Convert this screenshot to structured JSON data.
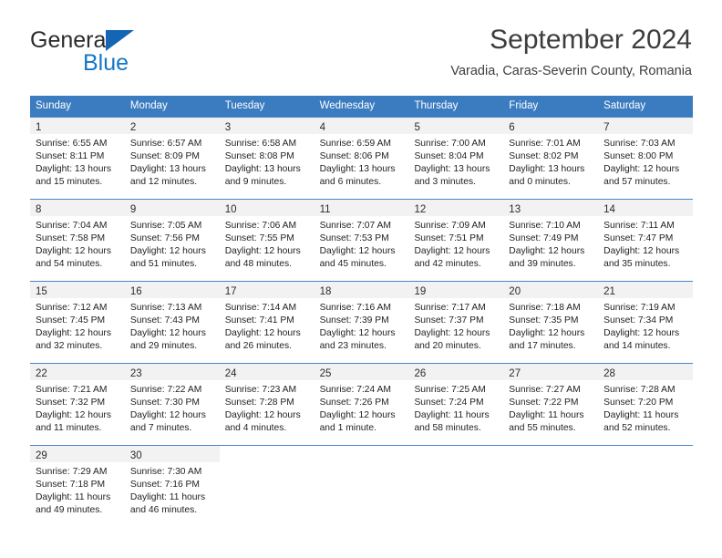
{
  "brand": {
    "word_one": "General",
    "word_two": "Blue",
    "accent_color": "#1477c7",
    "triangle_color": "#1565b5",
    "logo_icon": "general-blue-logo"
  },
  "header": {
    "month_title": "September 2024",
    "location": "Varadia, Caras-Severin County, Romania"
  },
  "calendar": {
    "header_bg_color": "#3b7cc0",
    "date_band_color": "#f2f2f2",
    "weekdays": [
      "Sunday",
      "Monday",
      "Tuesday",
      "Wednesday",
      "Thursday",
      "Friday",
      "Saturday"
    ],
    "weeks": [
      [
        {
          "day": "1",
          "sunrise": "Sunrise: 6:55 AM",
          "sunset": "Sunset: 8:11 PM",
          "daylight_line1": "Daylight: 13 hours",
          "daylight_line2": "and 15 minutes."
        },
        {
          "day": "2",
          "sunrise": "Sunrise: 6:57 AM",
          "sunset": "Sunset: 8:09 PM",
          "daylight_line1": "Daylight: 13 hours",
          "daylight_line2": "and 12 minutes."
        },
        {
          "day": "3",
          "sunrise": "Sunrise: 6:58 AM",
          "sunset": "Sunset: 8:08 PM",
          "daylight_line1": "Daylight: 13 hours",
          "daylight_line2": "and 9 minutes."
        },
        {
          "day": "4",
          "sunrise": "Sunrise: 6:59 AM",
          "sunset": "Sunset: 8:06 PM",
          "daylight_line1": "Daylight: 13 hours",
          "daylight_line2": "and 6 minutes."
        },
        {
          "day": "5",
          "sunrise": "Sunrise: 7:00 AM",
          "sunset": "Sunset: 8:04 PM",
          "daylight_line1": "Daylight: 13 hours",
          "daylight_line2": "and 3 minutes."
        },
        {
          "day": "6",
          "sunrise": "Sunrise: 7:01 AM",
          "sunset": "Sunset: 8:02 PM",
          "daylight_line1": "Daylight: 13 hours",
          "daylight_line2": "and 0 minutes."
        },
        {
          "day": "7",
          "sunrise": "Sunrise: 7:03 AM",
          "sunset": "Sunset: 8:00 PM",
          "daylight_line1": "Daylight: 12 hours",
          "daylight_line2": "and 57 minutes."
        }
      ],
      [
        {
          "day": "8",
          "sunrise": "Sunrise: 7:04 AM",
          "sunset": "Sunset: 7:58 PM",
          "daylight_line1": "Daylight: 12 hours",
          "daylight_line2": "and 54 minutes."
        },
        {
          "day": "9",
          "sunrise": "Sunrise: 7:05 AM",
          "sunset": "Sunset: 7:56 PM",
          "daylight_line1": "Daylight: 12 hours",
          "daylight_line2": "and 51 minutes."
        },
        {
          "day": "10",
          "sunrise": "Sunrise: 7:06 AM",
          "sunset": "Sunset: 7:55 PM",
          "daylight_line1": "Daylight: 12 hours",
          "daylight_line2": "and 48 minutes."
        },
        {
          "day": "11",
          "sunrise": "Sunrise: 7:07 AM",
          "sunset": "Sunset: 7:53 PM",
          "daylight_line1": "Daylight: 12 hours",
          "daylight_line2": "and 45 minutes."
        },
        {
          "day": "12",
          "sunrise": "Sunrise: 7:09 AM",
          "sunset": "Sunset: 7:51 PM",
          "daylight_line1": "Daylight: 12 hours",
          "daylight_line2": "and 42 minutes."
        },
        {
          "day": "13",
          "sunrise": "Sunrise: 7:10 AM",
          "sunset": "Sunset: 7:49 PM",
          "daylight_line1": "Daylight: 12 hours",
          "daylight_line2": "and 39 minutes."
        },
        {
          "day": "14",
          "sunrise": "Sunrise: 7:11 AM",
          "sunset": "Sunset: 7:47 PM",
          "daylight_line1": "Daylight: 12 hours",
          "daylight_line2": "and 35 minutes."
        }
      ],
      [
        {
          "day": "15",
          "sunrise": "Sunrise: 7:12 AM",
          "sunset": "Sunset: 7:45 PM",
          "daylight_line1": "Daylight: 12 hours",
          "daylight_line2": "and 32 minutes."
        },
        {
          "day": "16",
          "sunrise": "Sunrise: 7:13 AM",
          "sunset": "Sunset: 7:43 PM",
          "daylight_line1": "Daylight: 12 hours",
          "daylight_line2": "and 29 minutes."
        },
        {
          "day": "17",
          "sunrise": "Sunrise: 7:14 AM",
          "sunset": "Sunset: 7:41 PM",
          "daylight_line1": "Daylight: 12 hours",
          "daylight_line2": "and 26 minutes."
        },
        {
          "day": "18",
          "sunrise": "Sunrise: 7:16 AM",
          "sunset": "Sunset: 7:39 PM",
          "daylight_line1": "Daylight: 12 hours",
          "daylight_line2": "and 23 minutes."
        },
        {
          "day": "19",
          "sunrise": "Sunrise: 7:17 AM",
          "sunset": "Sunset: 7:37 PM",
          "daylight_line1": "Daylight: 12 hours",
          "daylight_line2": "and 20 minutes."
        },
        {
          "day": "20",
          "sunrise": "Sunrise: 7:18 AM",
          "sunset": "Sunset: 7:35 PM",
          "daylight_line1": "Daylight: 12 hours",
          "daylight_line2": "and 17 minutes."
        },
        {
          "day": "21",
          "sunrise": "Sunrise: 7:19 AM",
          "sunset": "Sunset: 7:34 PM",
          "daylight_line1": "Daylight: 12 hours",
          "daylight_line2": "and 14 minutes."
        }
      ],
      [
        {
          "day": "22",
          "sunrise": "Sunrise: 7:21 AM",
          "sunset": "Sunset: 7:32 PM",
          "daylight_line1": "Daylight: 12 hours",
          "daylight_line2": "and 11 minutes."
        },
        {
          "day": "23",
          "sunrise": "Sunrise: 7:22 AM",
          "sunset": "Sunset: 7:30 PM",
          "daylight_line1": "Daylight: 12 hours",
          "daylight_line2": "and 7 minutes."
        },
        {
          "day": "24",
          "sunrise": "Sunrise: 7:23 AM",
          "sunset": "Sunset: 7:28 PM",
          "daylight_line1": "Daylight: 12 hours",
          "daylight_line2": "and 4 minutes."
        },
        {
          "day": "25",
          "sunrise": "Sunrise: 7:24 AM",
          "sunset": "Sunset: 7:26 PM",
          "daylight_line1": "Daylight: 12 hours",
          "daylight_line2": "and 1 minute."
        },
        {
          "day": "26",
          "sunrise": "Sunrise: 7:25 AM",
          "sunset": "Sunset: 7:24 PM",
          "daylight_line1": "Daylight: 11 hours",
          "daylight_line2": "and 58 minutes."
        },
        {
          "day": "27",
          "sunrise": "Sunrise: 7:27 AM",
          "sunset": "Sunset: 7:22 PM",
          "daylight_line1": "Daylight: 11 hours",
          "daylight_line2": "and 55 minutes."
        },
        {
          "day": "28",
          "sunrise": "Sunrise: 7:28 AM",
          "sunset": "Sunset: 7:20 PM",
          "daylight_line1": "Daylight: 11 hours",
          "daylight_line2": "and 52 minutes."
        }
      ],
      [
        {
          "day": "29",
          "sunrise": "Sunrise: 7:29 AM",
          "sunset": "Sunset: 7:18 PM",
          "daylight_line1": "Daylight: 11 hours",
          "daylight_line2": "and 49 minutes."
        },
        {
          "day": "30",
          "sunrise": "Sunrise: 7:30 AM",
          "sunset": "Sunset: 7:16 PM",
          "daylight_line1": "Daylight: 11 hours",
          "daylight_line2": "and 46 minutes."
        },
        {
          "day": "",
          "sunrise": "",
          "sunset": "",
          "daylight_line1": "",
          "daylight_line2": ""
        },
        {
          "day": "",
          "sunrise": "",
          "sunset": "",
          "daylight_line1": "",
          "daylight_line2": ""
        },
        {
          "day": "",
          "sunrise": "",
          "sunset": "",
          "daylight_line1": "",
          "daylight_line2": ""
        },
        {
          "day": "",
          "sunrise": "",
          "sunset": "",
          "daylight_line1": "",
          "daylight_line2": ""
        },
        {
          "day": "",
          "sunrise": "",
          "sunset": "",
          "daylight_line1": "",
          "daylight_line2": ""
        }
      ]
    ]
  }
}
